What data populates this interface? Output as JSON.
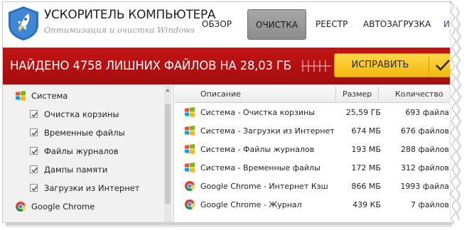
{
  "header": {
    "app_title": "УСКОРИТЕЛЬ КОМПЬЮТЕРА",
    "app_subtitle": "Оптимизация и очистка Windows",
    "tabs": [
      {
        "label": "ОБЗОР",
        "active": false
      },
      {
        "label": "ОЧИСТКА",
        "active": true
      },
      {
        "label": "РЕЕСТР",
        "active": false
      },
      {
        "label": "АВТОЗАГРУЗКА",
        "active": false
      },
      {
        "label": "ИН",
        "active": false
      }
    ]
  },
  "banner": {
    "text": "НАЙДЕНО 4758 ЛИШНИХ ФАЙЛОВ НА 28,03 ГБ",
    "fix_label": "ИСПРАВИТЬ"
  },
  "sidebar": {
    "items": [
      {
        "label": "Система",
        "icon": "windows-icon",
        "type": "group"
      },
      {
        "label": "Очистка корзины",
        "checked": true,
        "type": "option"
      },
      {
        "label": "Временные файлы",
        "checked": true,
        "type": "option"
      },
      {
        "label": "Файлы журналов",
        "checked": true,
        "type": "option"
      },
      {
        "label": "Дампы памяти",
        "checked": true,
        "type": "option"
      },
      {
        "label": "Загрузки из Интернет",
        "checked": true,
        "type": "option"
      },
      {
        "label": "Google Chrome",
        "icon": "chrome-icon",
        "type": "group"
      }
    ]
  },
  "table": {
    "columns": [
      "Описание",
      "Размер",
      "Количество"
    ],
    "rows": [
      {
        "icon": "windows-icon",
        "description": "Система - Очистка корзины",
        "size": "25,59 ГБ",
        "count": "693 файла"
      },
      {
        "icon": "windows-icon",
        "description": "Система - Загрузки из Интернет",
        "size": "674 МБ",
        "count": "676 файлов"
      },
      {
        "icon": "windows-icon",
        "description": "Система - Файлы журналов",
        "size": "193 МБ",
        "count": "288 файлов"
      },
      {
        "icon": "windows-icon",
        "description": "Система - Временные файлы",
        "size": "172 МБ",
        "count": "312 файлов"
      },
      {
        "icon": "chrome-icon",
        "description": "Google Chrome - Интернет Кэш",
        "size": "866 МБ",
        "count": "1993 файла"
      },
      {
        "icon": "chrome-icon",
        "description": "Google Chrome - Журнал",
        "size": "439 КБ",
        "count": "7 файлов"
      }
    ]
  },
  "colors": {
    "banner_red": "#b51111",
    "fix_button_yellow": "#f7c61e",
    "active_tab_gray": "#9a9a9a",
    "link_blue": "#1d4fa8"
  }
}
